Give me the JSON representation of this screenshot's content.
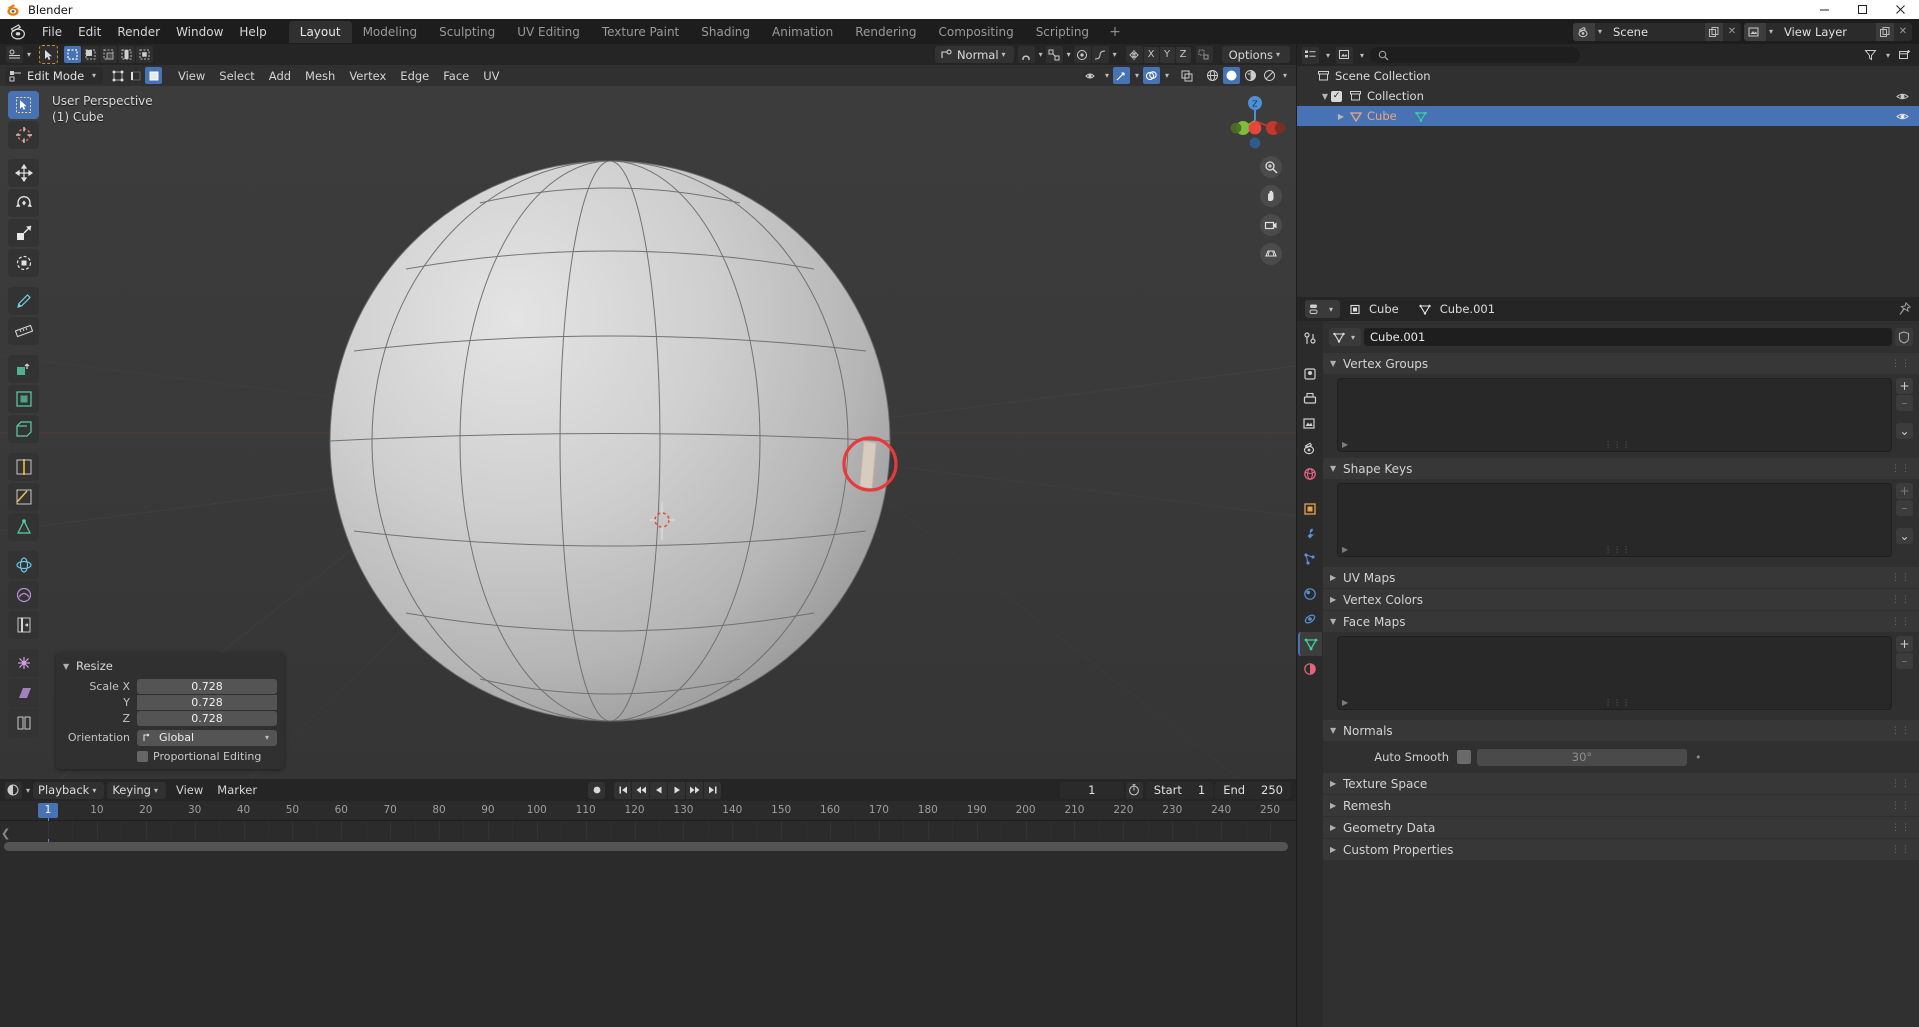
{
  "window": {
    "title": "Blender",
    "controls": {
      "minimize": "–",
      "maximize": "☐",
      "close": "✕"
    }
  },
  "topbar": {
    "menus": [
      "File",
      "Edit",
      "Render",
      "Window",
      "Help"
    ],
    "workspaces": [
      "Layout",
      "Modeling",
      "Sculpting",
      "UV Editing",
      "Texture Paint",
      "Shading",
      "Animation",
      "Rendering",
      "Compositing",
      "Scripting"
    ],
    "active_workspace": "Layout",
    "add_workspace": "+",
    "scene": {
      "label": "Scene",
      "icon": "scene-icon",
      "new_icon": "duplicate-icon",
      "unlink_icon": "x-icon"
    },
    "view_layer": {
      "label": "View Layer",
      "icon": "view-layer-icon",
      "new_icon": "duplicate-icon",
      "unlink_icon": "x-icon"
    }
  },
  "viewport_header": {
    "editor_type": "editor-type-icon",
    "cursor_tool": "cursor-icon",
    "select_modes": [
      "set-select",
      "extend-select",
      "subtract-select",
      "invert-select",
      "intersect-select"
    ],
    "active_select_mode": 0,
    "transform_orientation": "Normal",
    "snap_icon": "magnet-icon",
    "proportional_icon": "proportional-icon",
    "falloff_icon": "falloff-icon",
    "mirror_icon": "mirror-icon",
    "axes": [
      "X",
      "Y",
      "Z"
    ],
    "options_label": "Options"
  },
  "mode_header": {
    "mode": "Edit Mode",
    "mesh_select_modes": [
      "vertex",
      "edge",
      "face"
    ],
    "active_mesh_select": 2,
    "menus": [
      "View",
      "Select",
      "Add",
      "Mesh",
      "Vertex",
      "Edge",
      "Face",
      "UV"
    ],
    "right_icons": [
      "visibility-icon",
      "gizmo-icon",
      "overlays-icon",
      "xray-icon",
      "shading-wireframe-icon",
      "shading-solid-icon",
      "shading-material-icon",
      "shading-rendered-icon"
    ]
  },
  "viewport": {
    "overlay_line1": "User Perspective",
    "overlay_line2": "(1) Cube",
    "toolbar": [
      "tweak-tool",
      "cursor-tool",
      "move-tool",
      "rotate-tool",
      "scale-tool",
      "transform-tool",
      "annotate-tool",
      "measure-tool",
      "extrude-region-tool",
      "inset-faces-tool",
      "bevel-tool",
      "loop-cut-tool",
      "knife-tool",
      "poly-build-tool",
      "spin-tool",
      "smooth-tool",
      "edge-slide-tool",
      "shrink-fatten-tool",
      "shear-tool",
      "rip-region-tool"
    ],
    "active_tool": "tweak-tool",
    "nav_buttons": [
      "zoom-icon",
      "pan-icon",
      "camera-icon",
      "ortho-persp-icon"
    ],
    "gizmo_axes": [
      "X",
      "Y",
      "Z"
    ]
  },
  "operator_panel": {
    "title": "Resize",
    "rows": [
      {
        "label": "Scale X",
        "value": "0.728"
      },
      {
        "label": "Y",
        "value": "0.728"
      },
      {
        "label": "Z",
        "value": "0.728"
      }
    ],
    "orientation_label": "Orientation",
    "orientation_value": "Global",
    "proportional_editing_label": "Proportional Editing",
    "proportional_editing_checked": false
  },
  "timeline": {
    "menus": [
      "View",
      "Marker"
    ],
    "playback_label": "Playback",
    "keying_label": "Keying",
    "transport": [
      "record-icon",
      "jump-start-icon",
      "prev-keyframe-icon",
      "play-reverse-icon",
      "play-icon",
      "next-keyframe-icon",
      "jump-end-icon"
    ],
    "current_frame": "1",
    "start_label": "Start",
    "start_value": "1",
    "end_label": "End",
    "end_value": "250",
    "ticks": [
      "1",
      "10",
      "20",
      "30",
      "40",
      "50",
      "60",
      "70",
      "80",
      "90",
      "100",
      "110",
      "120",
      "130",
      "140",
      "150",
      "160",
      "170",
      "180",
      "190",
      "200",
      "210",
      "220",
      "230",
      "240",
      "250"
    ],
    "playhead_frame": "1"
  },
  "outliner": {
    "display_mode_icon": "outliner-display-icon",
    "filter_scene_icon": "view-layer-icon",
    "search_placeholder": "",
    "filter_icon": "filter-icon",
    "new_collection_icon": "new-collection-icon",
    "rows": [
      {
        "name": "Scene Collection",
        "icon": "collection-icon",
        "indent": 0,
        "selected": false,
        "has_tri": false,
        "has_check": false,
        "eye": false,
        "color": "default"
      },
      {
        "name": "Collection",
        "icon": "collection-icon",
        "indent": 1,
        "selected": false,
        "has_tri": true,
        "tri": "▼",
        "has_check": true,
        "eye": true,
        "color": "default"
      },
      {
        "name": "Cube",
        "icon": "mesh-object-icon",
        "indent": 2,
        "selected": true,
        "has_tri": true,
        "tri": "▶",
        "has_check": false,
        "eye": true,
        "color": "object",
        "data_icon": "mesh-data-icon"
      }
    ]
  },
  "properties": {
    "breadcrumb": {
      "editor_icon": "properties-editor-icon",
      "object_icon": "object-icon",
      "object_name": "Cube",
      "data_icon": "mesh-data-icon",
      "data_name": "Cube.001",
      "pin_icon": "pin-icon"
    },
    "tabs": [
      "tool-tab",
      "render-tab",
      "output-tab",
      "view-layer-tab",
      "scene-tab",
      "world-tab",
      "object-tab",
      "modifiers-tab",
      "particles-tab",
      "physics-tab",
      "constraints-tab",
      "object-data-tab",
      "material-tab"
    ],
    "active_tab": "object-data-tab",
    "data_name_icon": "mesh-data-icon",
    "data_name_value": "Cube.001",
    "shield_icon": "fake-user-icon",
    "panels": [
      {
        "name": "Vertex Groups",
        "open": true,
        "type": "list",
        "plus": "+",
        "minus": "–",
        "menu": "⌄"
      },
      {
        "name": "Shape Keys",
        "open": true,
        "type": "list",
        "plus": "+",
        "minus": "–",
        "menu": "⌄"
      },
      {
        "name": "UV Maps",
        "open": false,
        "type": "closed"
      },
      {
        "name": "Vertex Colors",
        "open": false,
        "type": "closed"
      },
      {
        "name": "Face Maps",
        "open": true,
        "type": "list",
        "plus": "+",
        "minus": "–",
        "menu": ""
      },
      {
        "name": "Normals",
        "open": true,
        "type": "normals"
      },
      {
        "name": "Texture Space",
        "open": false,
        "type": "closed"
      },
      {
        "name": "Remesh",
        "open": false,
        "type": "closed"
      },
      {
        "name": "Geometry Data",
        "open": false,
        "type": "closed"
      },
      {
        "name": "Custom Properties",
        "open": false,
        "type": "closed"
      }
    ],
    "normals": {
      "auto_smooth_label": "Auto Smooth",
      "auto_smooth_checked": false,
      "angle_value": "30°"
    }
  },
  "colors": {
    "accent_blue": "#4772b3",
    "object_orange": "#e8a87c",
    "mesh_green": "#3bd1a0",
    "selection_red": "#e8393c",
    "header_bg": "#252525",
    "panel_bg": "#303030",
    "viewport_bg": "#393939"
  }
}
